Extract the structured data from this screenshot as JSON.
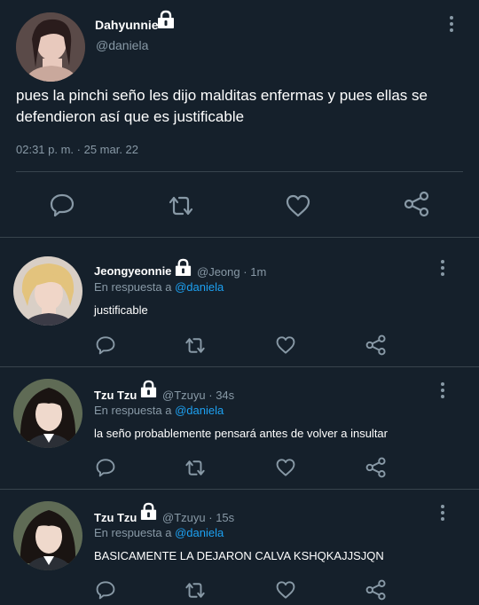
{
  "main_tweet": {
    "name": "Dahyunnie",
    "handle": "@daniela",
    "text": "pues la pinchi seño les dijo malditas enfermas y pues ellas se defendieron así que es justificable",
    "timestamp": "02:31 p. m. · 25 mar. 22"
  },
  "replies": [
    {
      "name": "Jeongyeonnie",
      "handle": "@Jeong",
      "time": "1m",
      "in_reply_prefix": "En respuesta a",
      "in_reply_handle": "@daniela",
      "text": "justificable"
    },
    {
      "name": "Tzu Tzu",
      "handle": "@Tzuyu",
      "time": "34s",
      "in_reply_prefix": "En respuesta a",
      "in_reply_handle": "@daniela",
      "text": "la seño probablemente pensará antes de volver a insultar"
    },
    {
      "name": "Tzu Tzu",
      "handle": "@Tzuyu",
      "time": "15s",
      "in_reply_prefix": "En respuesta a",
      "in_reply_handle": "@daniela",
      "text": "BASICAMENTE LA DEJARON CALVA KSHQKAJJSJQN"
    }
  ],
  "separator": "·",
  "icons": {
    "reply": "comment-icon",
    "retweet": "retweet-icon",
    "like": "heart-icon",
    "share": "share-icon",
    "lock": "lock-icon",
    "more": "more-vertical-icon"
  },
  "colors": {
    "background": "#15202b",
    "text": "#ffffff",
    "muted": "#8899a6",
    "link": "#1da1f2",
    "divider": "#38444d"
  }
}
